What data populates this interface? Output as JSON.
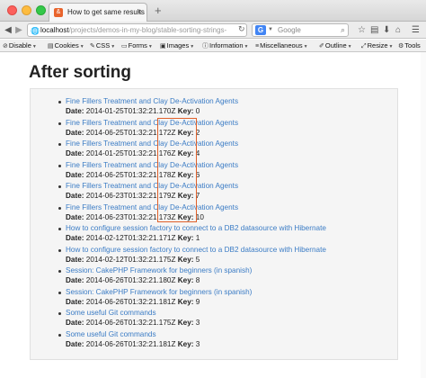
{
  "browser": {
    "tab_title": "How to get same results ...",
    "tab_favicon": "&",
    "tab_close": "×",
    "new_tab": "+",
    "back": "◀",
    "forward": "▶",
    "url_host": "localhost",
    "url_path": "/projects/demos-in-my-blog/stable-sorting-strings-",
    "reload": "↻",
    "search_engine_icon": "G",
    "search_placeholder": "Google",
    "search_go": "⌕",
    "icons": {
      "back": "back-arrow-icon",
      "forward": "forward-arrow-icon",
      "globe": "globe-icon",
      "reload": "reload-icon",
      "download": "download-icon",
      "home": "home-icon",
      "menu": "hamburger-menu-icon"
    }
  },
  "devbar": {
    "items": [
      {
        "label": "Disable",
        "icon": "⊘",
        "caret": "▼"
      },
      {
        "label": "Cookies",
        "icon": "▤",
        "caret": "▼"
      },
      {
        "label": "CSS",
        "icon": "✎",
        "caret": "▼"
      },
      {
        "label": "Forms",
        "icon": "▭",
        "caret": "▼"
      },
      {
        "label": "Images",
        "icon": "▣",
        "caret": "▼"
      },
      {
        "label": "Information",
        "icon": "ⓘ",
        "caret": "▼"
      },
      {
        "label": "Miscellaneous",
        "icon": "≡",
        "caret": "▼"
      },
      {
        "label": "Outline",
        "icon": "✐",
        "caret": "▼"
      },
      {
        "label": "Resize",
        "icon": "⤢",
        "caret": "▼"
      },
      {
        "label": "Tools",
        "icon": "⚙",
        "caret": "▼"
      }
    ]
  },
  "page": {
    "title": "After sorting",
    "date_label": "Date:",
    "key_label": "Key:",
    "highlight_color": "#e0602a",
    "link_color": "#3b7cc5",
    "items": [
      {
        "title": "Fine Fillers Treatment and Clay De-Activation Agents",
        "date": "2014-01-25T01:32:21.170Z",
        "key": "0"
      },
      {
        "title": "Fine Fillers Treatment and Clay De-Activation Agents",
        "date": "2014-06-25T01:32:21.172Z",
        "key": "2"
      },
      {
        "title": "Fine Fillers Treatment and Clay De-Activation Agents",
        "date": "2014-01-25T01:32:21.176Z",
        "key": "4"
      },
      {
        "title": "Fine Fillers Treatment and Clay De-Activation Agents",
        "date": "2014-06-25T01:32:21.178Z",
        "key": "6"
      },
      {
        "title": "Fine Fillers Treatment and Clay De-Activation Agents",
        "date": "2014-06-23T01:32:21.179Z",
        "key": "7"
      },
      {
        "title": "Fine Fillers Treatment and Clay De-Activation Agents",
        "date": "2014-06-23T01:32:21.173Z",
        "key": "10"
      },
      {
        "title": "How to configure session factory to connect to a DB2 datasource with Hibernate",
        "date": "2014-02-12T01:32:21.171Z",
        "key": "1"
      },
      {
        "title": "How to configure session factory to connect to a DB2 datasource with Hibernate",
        "date": "2014-02-12T01:32:21.175Z",
        "key": "5"
      },
      {
        "title": "Session: CakePHP Framework for beginners (in spanish)",
        "date": "2014-06-26T01:32:21.180Z",
        "key": "8"
      },
      {
        "title": "Session: CakePHP Framework for beginners (in spanish)",
        "date": "2014-06-26T01:32:21.181Z",
        "key": "9"
      },
      {
        "title": "Some useful Git commands",
        "date": "2014-06-26T01:32:21.175Z",
        "key": "3"
      },
      {
        "title": "Some useful Git commands",
        "date": "2014-06-26T01:32:21.181Z",
        "key": "3"
      }
    ]
  }
}
